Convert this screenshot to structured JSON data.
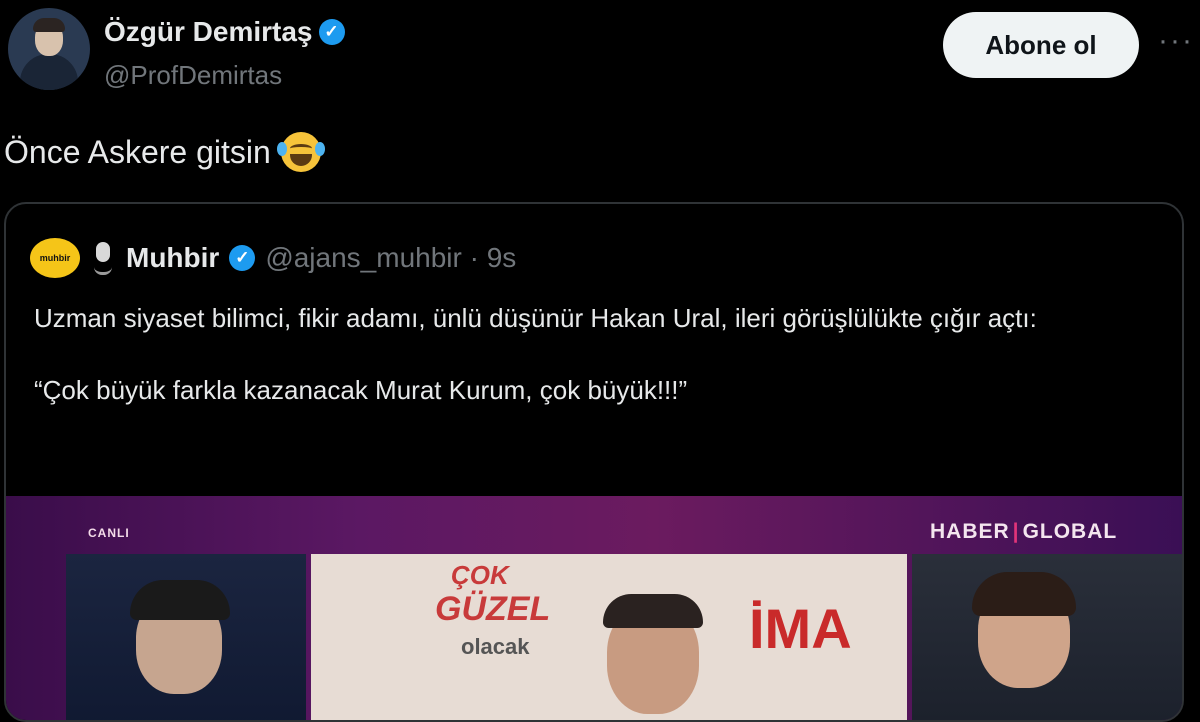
{
  "author": {
    "display_name": "Özgür Demirtaş",
    "handle": "@ProfDemirtas",
    "verified_mark": "✓"
  },
  "actions": {
    "follow_label": "Abone ol",
    "more_label": "···"
  },
  "tweet": {
    "text": "Önce Askere gitsin"
  },
  "quoted": {
    "logo_text": "muhbir",
    "display_name": "Muhbir",
    "verified_mark": "✓",
    "handle_time": "@ajans_muhbir · 9s",
    "paragraph1": "Uzman siyaset bilimci, fikir adamı, ünlü düşünür Hakan Ural, ileri görüşlülükte çığır açtı:",
    "paragraph2": "“Çok büyük farkla kazanacak Murat Kurum, çok büyük!!!”"
  },
  "media": {
    "live_label": "CANLI",
    "channel_left": "HABER",
    "channel_right": "GLOBAL",
    "slogan_top": "ÇOK",
    "slogan_mid": "GÜZEL",
    "slogan_bottom": "olacak",
    "bg_word": "İMA"
  },
  "colors": {
    "background": "#000000",
    "accent": "#1d9bf0",
    "muted": "#71767b"
  }
}
